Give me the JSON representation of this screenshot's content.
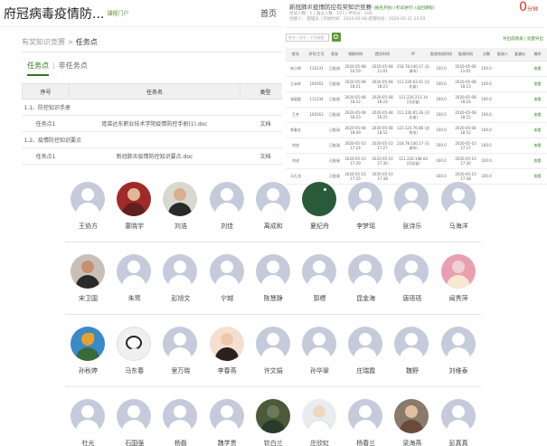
{
  "left_panel": {
    "site_title": "府冠病毒疫情防...",
    "site_sub": "课程门户",
    "nav": [
      "首页",
      "活"
    ],
    "breadcrumb": {
      "parent": "有奖知识竞赛",
      "sep": " > ",
      "current": "任务点"
    },
    "tabs": {
      "active": "任务点",
      "sep": "|",
      "inactive": "非任务点"
    },
    "table": {
      "headers": [
        "序号",
        "任务名",
        "类型"
      ],
      "rows": [
        {
          "kind": "group",
          "text": "1.1、防控知识手册"
        },
        {
          "kind": "item",
          "num": "任务点1",
          "name": "庞菜达东职业技术学院疫情防控手册(1).doc",
          "type": "文档"
        },
        {
          "kind": "group",
          "text": "1.2、疫情防控知识要点"
        },
        {
          "kind": "item",
          "num": "任务点1",
          "name": "新冠肺炎疫情防控知识要点.doc",
          "type": "文档"
        }
      ]
    }
  },
  "right_panel": {
    "title": "新冠肺炎疫情防控有奖知识竞赛",
    "title_tags": "(报名开始) (考试进行) (返回课程)",
    "info1": "考试人数：1 | 通过人数：107 | 平均分：100",
    "info2": "创建人： 管理员 | 开始时间：2020-05-08 结束时间：2020-05-31 23:59",
    "score": "0",
    "score_unit": "分钟",
    "search_placeholder": "姓名 / 学号 / 工号搜索",
    "export": "导出成绩表 | 批量导出",
    "headers": [
      "姓名",
      "学号/工号",
      "状态",
      "领取时间",
      "提交时间",
      "IP",
      "批阅完成时间",
      "批阅时间",
      "分数",
      "批阅人",
      "复查Ip",
      "操作"
    ],
    "rows": [
      [
        "宋小转",
        "110131",
        "已批阅",
        "2020-05-08 10:59",
        "2020-05-08 11:01",
        "218.78.140.17 (天津市)",
        "100.0",
        "2020-05-08 11:01",
        "100.0",
        "",
        "",
        "查看"
      ],
      [
        "王赤欢",
        "100161",
        "已批阅",
        "2020-05-08 18:21",
        "2020-05-08 18:23",
        "111.226.63.41 (河北省)",
        "100.0",
        "2020-05-08 18:23",
        "100.0",
        "",
        "",
        "查看"
      ],
      [
        "张琨琨",
        "111234",
        "已批阅",
        "2020-05-08 18:22",
        "2020-05-08 18:24",
        "111.226.213.14 (河北省)",
        "100.0",
        "2020-05-08 18:24",
        "100.0",
        "",
        "",
        "查看"
      ],
      [
        "王冬",
        "100163",
        "已批阅",
        "2020-05-08 18:23",
        "2020-05-08 18:25",
        "111.226.65.26 (河北省)",
        "100.0",
        "2020-05-08 18:25",
        "100.0",
        "",
        "",
        "查看"
      ],
      [
        "李春艺",
        "",
        "已批阅",
        "2020-05-08 18:49",
        "2020-05-08 18:52",
        "123.123.76.86 (北京市)",
        "100.0",
        "2020-05-08 18:52",
        "100.0",
        "",
        "",
        "查看"
      ],
      [
        "刘启",
        "",
        "已批阅",
        "2020-05-10 17:24",
        "2020-05-10 17:27",
        "218.78.140.17 (天津市)",
        "100.0",
        "2020-05-10 17:27",
        "100.0",
        "",
        "",
        "查看"
      ],
      [
        "刘进",
        "",
        "已批阅",
        "2020-05-10 17:29",
        "2020-05-10 17:30",
        "111.226.198.64 (河北省)",
        "100.0",
        "2020-05-10 17:30",
        "100.0",
        "",
        "",
        "查看"
      ],
      [
        "马九龙",
        "",
        "已批阅",
        "2020-05-10 17:35",
        "2020-05-10 17:38",
        "",
        "100.0",
        "2020-05-10 17:38",
        "100.0",
        "",
        "",
        "查看"
      ]
    ]
  },
  "users": [
    {
      "name": "王协方",
      "avatar": "default"
    },
    {
      "name": "童晓宇",
      "avatar": "p-red"
    },
    {
      "name": "刘浩",
      "avatar": "p-dark"
    },
    {
      "name": "刘佳",
      "avatar": "default"
    },
    {
      "name": "离成和",
      "avatar": "default"
    },
    {
      "name": "夏纪舟",
      "avatar": "p-green"
    },
    {
      "name": "李梦瑶",
      "avatar": "default"
    },
    {
      "name": "张诗乐",
      "avatar": "default"
    },
    {
      "name": "马海洋",
      "avatar": "default"
    },
    {
      "name": "宋卫国",
      "avatar": "p-man"
    },
    {
      "name": "朱莺",
      "avatar": "default"
    },
    {
      "name": "彭旭文",
      "avatar": "default"
    },
    {
      "name": "宁越",
      "avatar": "default"
    },
    {
      "name": "陈慧静",
      "avatar": "default"
    },
    {
      "name": "郭標",
      "avatar": "default"
    },
    {
      "name": "昆金海",
      "avatar": "default"
    },
    {
      "name": "唐珸珸",
      "avatar": "default"
    },
    {
      "name": "闻秀萍",
      "avatar": "p-pink"
    },
    {
      "name": "孙秋婷",
      "avatar": "p-bird"
    },
    {
      "name": "马东春",
      "avatar": "p-panda"
    },
    {
      "name": "里万晓",
      "avatar": "default"
    },
    {
      "name": "李春燕",
      "avatar": "p-girl"
    },
    {
      "name": "许文娟",
      "avatar": "default"
    },
    {
      "name": "孙华翠",
      "avatar": "default"
    },
    {
      "name": "庄瑞霞",
      "avatar": "default"
    },
    {
      "name": "魏野",
      "avatar": "default"
    },
    {
      "name": "刘维泰",
      "avatar": "default"
    },
    {
      "name": "杜光",
      "avatar": "default"
    },
    {
      "name": "石国强",
      "avatar": "default"
    },
    {
      "name": "杨磊",
      "avatar": "default"
    },
    {
      "name": "魏学贵",
      "avatar": "default"
    },
    {
      "name": "钦白兰",
      "avatar": "p-bridge"
    },
    {
      "name": "庄欣虹",
      "avatar": "p-white"
    },
    {
      "name": "杨春兰",
      "avatar": "default"
    },
    {
      "name": "梁海燕",
      "avatar": "p-couple"
    },
    {
      "name": "彭真真",
      "avatar": "default"
    }
  ]
}
